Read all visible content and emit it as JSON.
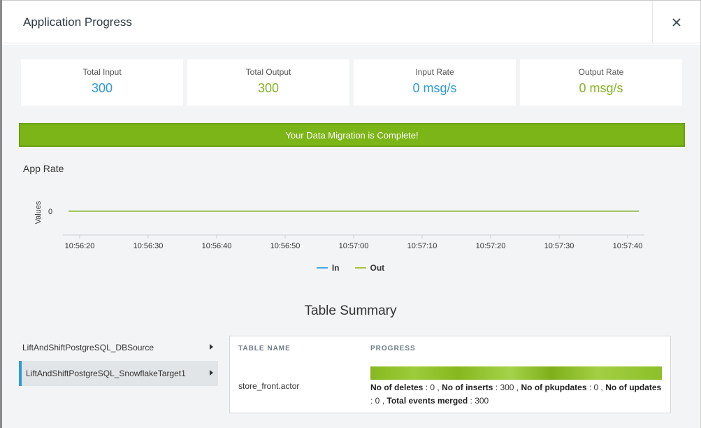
{
  "dialog": {
    "title": "Application Progress",
    "close_icon": "close-icon"
  },
  "stats": [
    {
      "label": "Total Input",
      "value": "300",
      "color": "#2d9ad8"
    },
    {
      "label": "Total Output",
      "value": "300",
      "color": "#86b327"
    },
    {
      "label": "Input Rate",
      "value": "0 msg/s",
      "color": "#2d9ad8"
    },
    {
      "label": "Output Rate",
      "value": "0 msg/s",
      "color": "#86b327"
    }
  ],
  "banner": {
    "message": "Your Data Migration is Complete!",
    "color": "#7cb518"
  },
  "chart_data": {
    "type": "line",
    "title": "App Rate",
    "xlabel": "",
    "ylabel": "Values",
    "x": [
      "10:56:20",
      "10:56:30",
      "10:56:40",
      "10:56:50",
      "10:57:00",
      "10:57:10",
      "10:57:20",
      "10:57:30",
      "10:57:40"
    ],
    "y_ticks": [
      "0"
    ],
    "series": [
      {
        "name": "In",
        "color": "#4ba6e0",
        "values": [
          0,
          0,
          0,
          0,
          0,
          0,
          0,
          0,
          0
        ]
      },
      {
        "name": "Out",
        "color": "#a9c23f",
        "values": [
          0,
          0,
          0,
          0,
          0,
          0,
          0,
          0,
          0
        ]
      }
    ],
    "legend_position": "bottom",
    "grid": false
  },
  "table_summary": {
    "title": "Table Summary",
    "sources": [
      {
        "label": "LiftAndShiftPostgreSQL_DBSource",
        "active": false
      },
      {
        "label": "LiftAndShiftPostgreSQL_SnowflakeTarget1",
        "active": true
      }
    ],
    "columns": [
      "TABLE NAME",
      "PROGRESS"
    ],
    "rows": [
      {
        "table_name": "store_front.actor",
        "progress_fraction": 1.0,
        "deletes_label": "No of deletes",
        "deletes": "0",
        "inserts_label": "No of inserts",
        "inserts": "300",
        "pkupdates_label": "No of pkupdates",
        "pkupdates": "0",
        "updates_label": "No of updates",
        "updates": "0",
        "merged_label": "Total events merged",
        "merged": "300"
      }
    ]
  }
}
